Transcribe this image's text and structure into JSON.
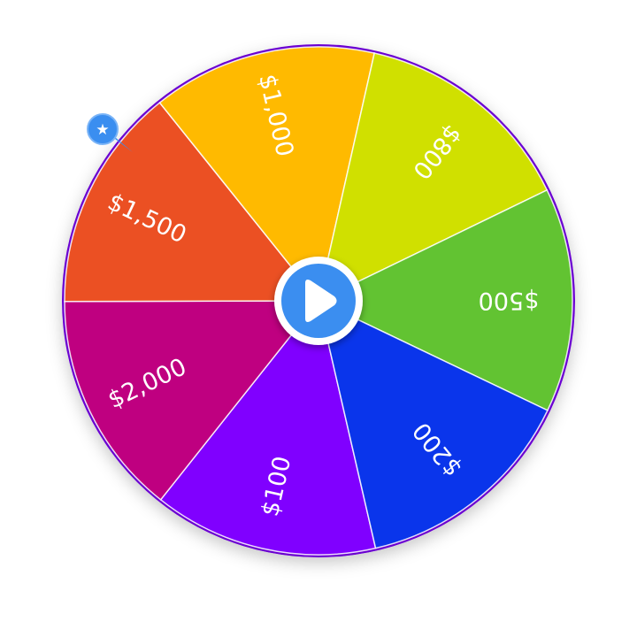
{
  "wheel": {
    "segments": [
      {
        "label": "$100",
        "color": "#8000ff"
      },
      {
        "label": "$2,000",
        "color": "#bf0080"
      },
      {
        "label": "$1,500",
        "color": "#eb5023"
      },
      {
        "label": "$1,000",
        "color": "#ffba00"
      },
      {
        "label": "$800",
        "color": "#d0e000"
      },
      {
        "label": "$500",
        "color": "#62c332"
      },
      {
        "label": "$200",
        "color": "#0a35eb"
      }
    ],
    "rim_color": "#6a00d0",
    "divider_color": "#ffffff"
  },
  "spin_button": {
    "icon": "play-icon",
    "color": "#3a8ef0",
    "ring_color": "#ffffff"
  },
  "marker": {
    "icon": "star-icon",
    "color": "#3a8ef0"
  }
}
